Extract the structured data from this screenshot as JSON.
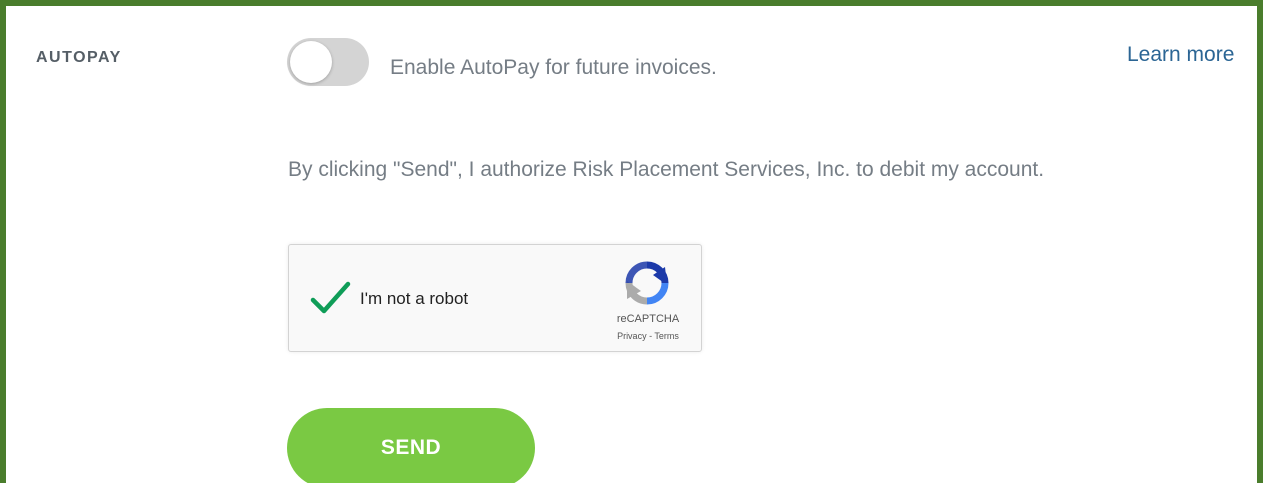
{
  "autopay": {
    "section_label": "AUTOPAY",
    "toggle_enabled": false,
    "toggle_text": "Enable AutoPay for future invoices.",
    "learn_more": "Learn more"
  },
  "authorization": {
    "text": "By clicking \"Send\", I authorize Risk Placement Services, Inc. to debit my account."
  },
  "captcha": {
    "checked": true,
    "label": "I'm not a robot",
    "brand": "reCAPTCHA",
    "privacy": "Privacy",
    "separator": " - ",
    "terms": "Terms"
  },
  "send": {
    "label": "SEND"
  },
  "colors": {
    "frame_border": "#4a7d2c",
    "send_button": "#7ac943",
    "link": "#2b6594",
    "check": "#0f9d58"
  }
}
